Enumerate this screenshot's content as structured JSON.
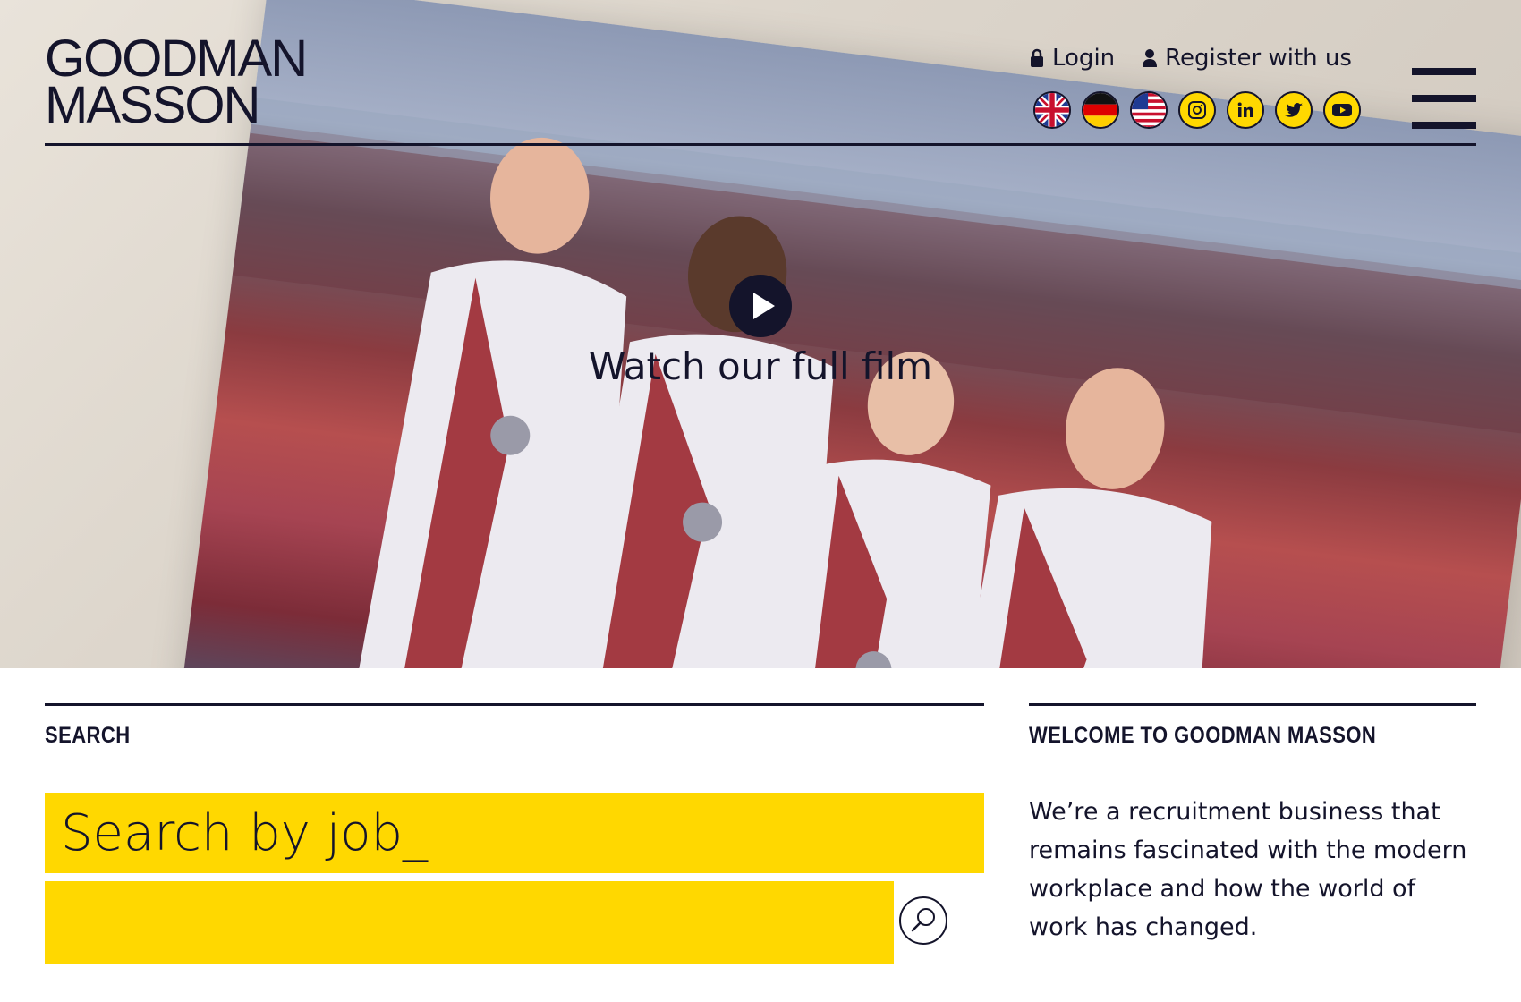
{
  "brand": {
    "line1": "GOODMAN",
    "line2": "MASSON"
  },
  "header": {
    "login_label": "Login",
    "register_label": "Register with us",
    "flags": [
      "uk-flag",
      "germany-flag",
      "usa-flag"
    ],
    "social": [
      "instagram-icon",
      "linkedin-icon",
      "twitter-icon",
      "youtube-icon"
    ]
  },
  "hero": {
    "cta_label": "Watch our full film"
  },
  "search": {
    "title": "SEARCH",
    "prompt": "Search by job_"
  },
  "welcome": {
    "title": "WELCOME TO GOODMAN MASSON",
    "body": "We’re a recruitment business that remains fascinated with the modern workplace and how the world of work has changed."
  },
  "colors": {
    "accent": "#ffd800",
    "ink": "#14142b"
  }
}
